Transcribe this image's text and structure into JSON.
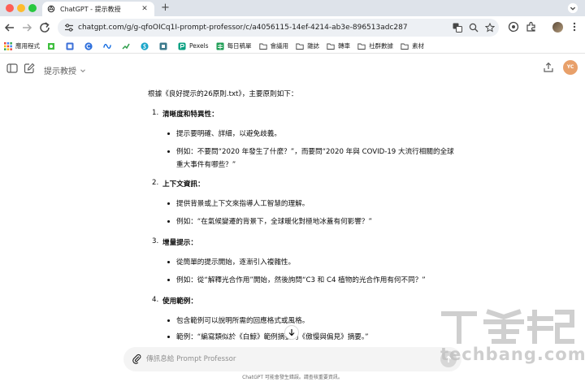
{
  "browser": {
    "tab_title": "ChatGPT - 提示教授",
    "tab_close_glyph": "✕",
    "new_tab_glyph": "+",
    "url": "chatgpt.com/g/g-qfoOICq1I-prompt-professor/c/a4056115-14ef-4214-ab3e-896513adc287",
    "colors": {
      "tabstrip": "#dee3ea",
      "omnibox": "#edf0f4"
    }
  },
  "bookmarks": [
    {
      "label": "應用程式",
      "icon": "apps-grid-icon"
    },
    {
      "label": "",
      "icon": "green-puzzle-icon"
    },
    {
      "label": "",
      "icon": "blue-square-icon"
    },
    {
      "label": "",
      "icon": "c-circle-icon"
    },
    {
      "label": "",
      "icon": "meta-icon"
    },
    {
      "label": "",
      "icon": "trend-icon"
    },
    {
      "label": "",
      "icon": "s-circle-icon"
    },
    {
      "label": "",
      "icon": "gray-square-icon"
    },
    {
      "label": "Pexels",
      "icon": "pexels-icon"
    },
    {
      "label": "每日稿單",
      "icon": "sheets-icon"
    },
    {
      "label": "會議用",
      "icon": "folder-icon"
    },
    {
      "label": "雜誌",
      "icon": "folder-icon"
    },
    {
      "label": "轉車",
      "icon": "folder-icon"
    },
    {
      "label": "社群數據",
      "icon": "folder-icon"
    },
    {
      "label": "素材",
      "icon": "folder-icon"
    }
  ],
  "app": {
    "gpt_name": "提示教授",
    "user_initials": "YC"
  },
  "message": {
    "intro": "根據《良好提示的26原則.txt》，主要原則如下：",
    "sections": [
      {
        "number": "1.",
        "title": "清晰度和特異性：",
        "bullets": [
          "提示要明確、詳細，以避免歧義。",
          "例如：不要問“2020 年發生了什麼？”，而要問“2020 年與 COVID-19 大流行相關的全球重大事件有哪些？”"
        ]
      },
      {
        "number": "2.",
        "title": "上下文資訊：",
        "bullets": [
          "提供背景或上下文來指導人工智慧的理解。",
          "例如：“在氣候變遷的背景下，全球暖化對極地冰蓋有何影響？”"
        ]
      },
      {
        "number": "3.",
        "title": "增量提示：",
        "bullets": [
          "從簡單的提示開始，逐漸引入複雜性。",
          "例如：從“解釋光合作用”開始，然後詢問“C3 和 C4 植物的光合作用有何不同？”"
        ]
      },
      {
        "number": "4.",
        "title": "使用範例：",
        "bullets": [
          "包含範例可以說明所需的回應格式或風格。",
          "範例：“編寫類似於《白鯨》範例摘要的《傲慢與偏見》摘要。”"
        ]
      }
    ]
  },
  "composer": {
    "placeholder": "傳訊息給 Prompt Professor",
    "value": ""
  },
  "disclaimer": "ChatGPT 可能會發生錯誤。請查核重要資訊。",
  "watermark": {
    "logo_text": "T客邦",
    "text": "techbang.com"
  }
}
